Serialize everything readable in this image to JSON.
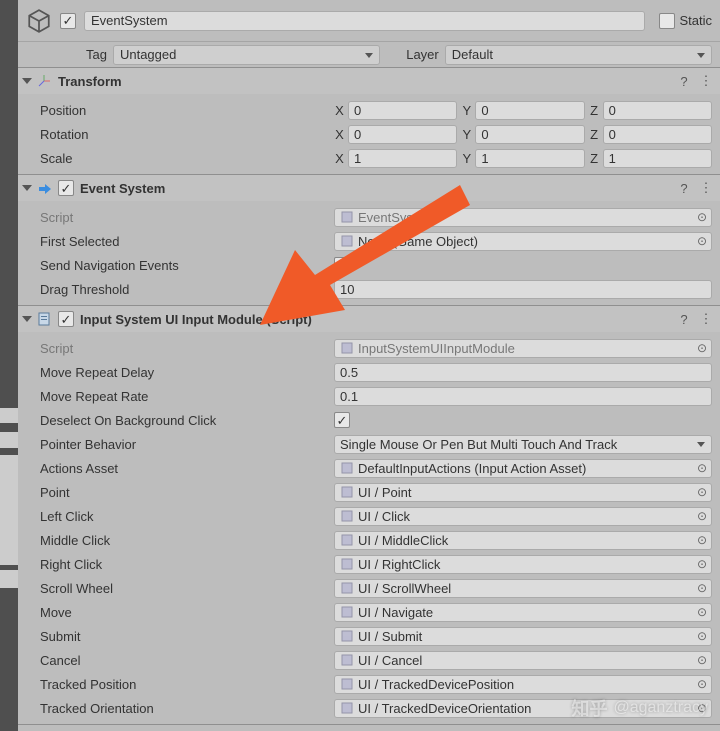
{
  "header": {
    "name": "EventSystem",
    "static_label": "Static",
    "static_checked": false,
    "enabled_checked": true
  },
  "tag_row": {
    "tag_label": "Tag",
    "tag_value": "Untagged",
    "layer_label": "Layer",
    "layer_value": "Default"
  },
  "transform": {
    "title": "Transform",
    "rows": {
      "position": {
        "label": "Position",
        "x": "0",
        "y": "0",
        "z": "0"
      },
      "rotation": {
        "label": "Rotation",
        "x": "0",
        "y": "0",
        "z": "0"
      },
      "scale": {
        "label": "Scale",
        "x": "1",
        "y": "1",
        "z": "1"
      }
    },
    "axis": {
      "x": "X",
      "y": "Y",
      "z": "Z"
    }
  },
  "event_system": {
    "title": "Event System",
    "enabled": true,
    "rows": [
      {
        "label": "Script",
        "type": "obj",
        "value": "EventSystem",
        "dim": true
      },
      {
        "label": "First Selected",
        "type": "obj",
        "value": "None (Game Object)"
      },
      {
        "label": "Send Navigation Events",
        "type": "check",
        "checked": true
      },
      {
        "label": "Drag Threshold",
        "type": "num",
        "value": "10"
      }
    ]
  },
  "input_module": {
    "title": "Input System UI Input Module (Script)",
    "enabled": true,
    "rows": [
      {
        "label": "Script",
        "type": "obj",
        "value": "InputSystemUIInputModule",
        "dim": true
      },
      {
        "label": "Move Repeat Delay",
        "type": "num",
        "value": "0.5"
      },
      {
        "label": "Move Repeat Rate",
        "type": "num",
        "value": "0.1"
      },
      {
        "label": "Deselect On Background Click",
        "type": "check",
        "checked": true
      },
      {
        "label": "Pointer Behavior",
        "type": "dd",
        "value": "Single Mouse Or Pen But Multi Touch And Track"
      },
      {
        "label": "Actions Asset",
        "type": "obj",
        "value": "DefaultInputActions (Input Action Asset)"
      },
      {
        "label": "Point",
        "type": "obj",
        "value": "UI / Point"
      },
      {
        "label": "Left Click",
        "type": "obj",
        "value": "UI / Click"
      },
      {
        "label": "Middle Click",
        "type": "obj",
        "value": "UI / MiddleClick"
      },
      {
        "label": "Right Click",
        "type": "obj",
        "value": "UI / RightClick"
      },
      {
        "label": "Scroll Wheel",
        "type": "obj",
        "value": "UI / ScrollWheel"
      },
      {
        "label": "Move",
        "type": "obj",
        "value": "UI / Navigate"
      },
      {
        "label": "Submit",
        "type": "obj",
        "value": "UI / Submit"
      },
      {
        "label": "Cancel",
        "type": "obj",
        "value": "UI / Cancel"
      },
      {
        "label": "Tracked Position",
        "type": "obj",
        "value": "UI / TrackedDevicePosition"
      },
      {
        "label": "Tracked Orientation",
        "type": "obj",
        "value": "UI / TrackedDeviceOrientation"
      }
    ]
  },
  "watermark": {
    "brand": "知乎",
    "at": "@aganztracy"
  }
}
